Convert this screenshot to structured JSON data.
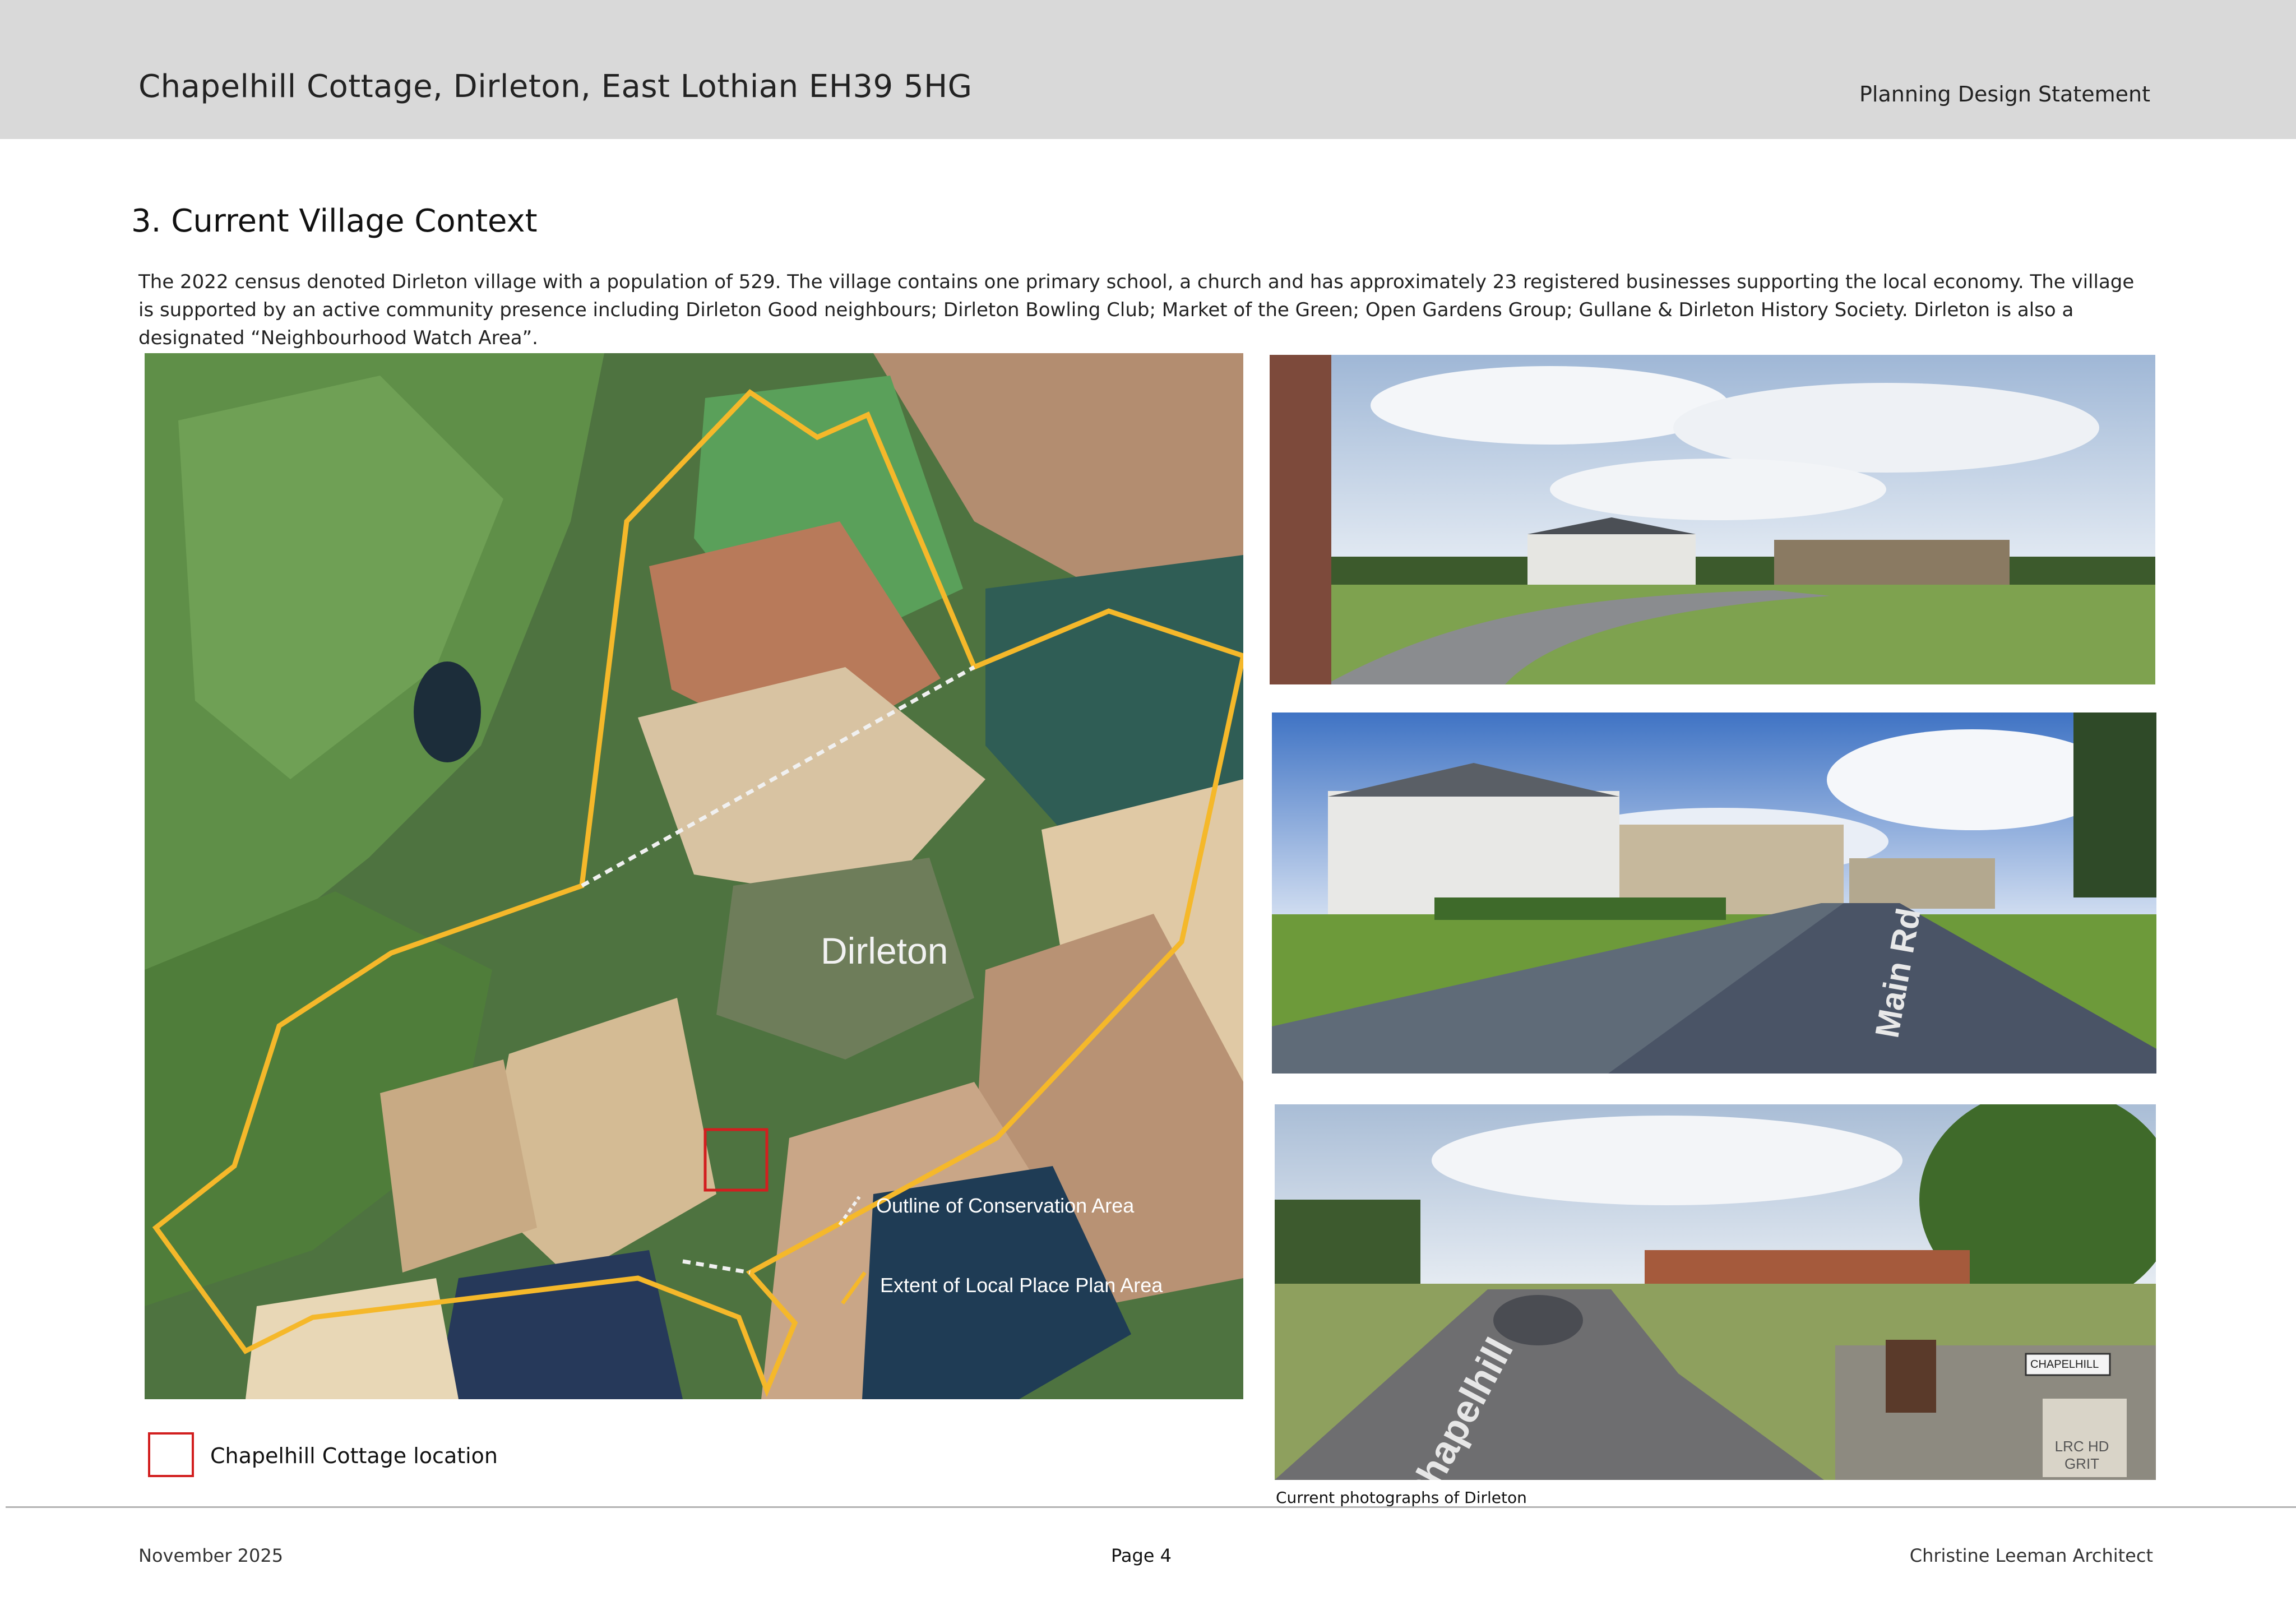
{
  "header": {
    "title": "Chapelhill Cottage, Dirleton, East Lothian EH39 5HG",
    "document_type": "Planning Design Statement"
  },
  "section": {
    "title": "3. Current Village Context",
    "intro": "The 2022 census denoted Dirleton village with a population of 529.  The village contains one primary school, a church and has approximately 23 registered businesses supporting the local economy. The village is supported by an active community presence including Dirleton Good neighbours; Dirleton Bowling Club; Market of the Green; Open Gardens Group; Gullane & Dirleton History Society. Dirleton is also a designated “Neighbourhood Watch Area”."
  },
  "map": {
    "place_label": "Dirleton",
    "legend_conservation": "Outline of Conservation Area",
    "legend_local_plan": "Extent of Local Place Plan Area",
    "site_legend": "Chapelhill Cottage location",
    "colors": {
      "conservation_outline": "#f0f0f0",
      "local_plan_outline": "#f5b82a",
      "site_marker": "#d21f1f"
    }
  },
  "photos": {
    "caption": "Current photographs of Dirleton",
    "road_sign_text": "Main Rd",
    "street_sign": "CHAPELHILL",
    "ground_text": "Chapelhill",
    "stone_text": "LRC HD GRIT"
  },
  "footer": {
    "date": "November 2025",
    "page": "Page  4",
    "author": "Christine Leeman Architect"
  }
}
